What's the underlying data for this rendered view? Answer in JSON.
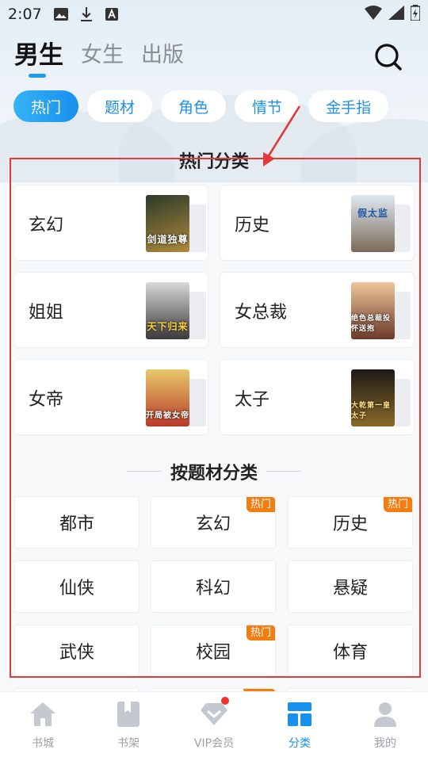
{
  "status_bar": {
    "time": "2:07"
  },
  "top_tabs": [
    {
      "label": "男生",
      "active": true
    },
    {
      "label": "女生",
      "active": false
    },
    {
      "label": "出版",
      "active": false
    }
  ],
  "chips": [
    {
      "label": "热门",
      "active": true
    },
    {
      "label": "题材",
      "active": false
    },
    {
      "label": "角色",
      "active": false
    },
    {
      "label": "情节",
      "active": false
    },
    {
      "label": "金手指",
      "active": false
    }
  ],
  "hot_section": {
    "title": "热门分类",
    "cards": [
      {
        "label": "玄幻",
        "cover_text": "剑道独尊",
        "cover_colors": [
          "#2b3a2a",
          "#b08a3a"
        ]
      },
      {
        "label": "历史",
        "cover_text": "假太监",
        "cover_colors": [
          "#dfe9f2",
          "#7d6b58"
        ]
      },
      {
        "label": "姐姐",
        "cover_text": "天下归来",
        "cover_colors": [
          "#d8d8d8",
          "#3a3a3a"
        ]
      },
      {
        "label": "女总裁",
        "cover_text": "绝色总裁投怀送抱",
        "cover_colors": [
          "#f0c59a",
          "#6b3a2a"
        ]
      },
      {
        "label": "女帝",
        "cover_text": "开局被女帝",
        "cover_colors": [
          "#e8c86a",
          "#b83a2a"
        ]
      },
      {
        "label": "太子",
        "cover_text": "大乾第一皇太子",
        "cover_colors": [
          "#1d1a16",
          "#8a6a2a"
        ]
      }
    ]
  },
  "theme_section": {
    "title": "按题材分类",
    "items": [
      {
        "label": "都市",
        "badge": ""
      },
      {
        "label": "玄幻",
        "badge": "热门"
      },
      {
        "label": "历史",
        "badge": "热门"
      },
      {
        "label": "仙侠",
        "badge": ""
      },
      {
        "label": "科幻",
        "badge": ""
      },
      {
        "label": "悬疑",
        "badge": ""
      },
      {
        "label": "武侠",
        "badge": ""
      },
      {
        "label": "校园",
        "badge": "热门"
      },
      {
        "label": "体育",
        "badge": ""
      }
    ]
  },
  "bottom_nav": [
    {
      "label": "书城",
      "icon": "home-icon",
      "active": false
    },
    {
      "label": "书架",
      "icon": "bookshelf-icon",
      "active": false
    },
    {
      "label": "VIP会员",
      "icon": "diamond-icon",
      "active": false,
      "dot": true
    },
    {
      "label": "分类",
      "icon": "category-icon",
      "active": true
    },
    {
      "label": "我的",
      "icon": "profile-icon",
      "active": false
    }
  ],
  "colors": {
    "accent": "#1890ee",
    "hot_badge": "#f57c0f",
    "annotation": "#e03a3a"
  }
}
